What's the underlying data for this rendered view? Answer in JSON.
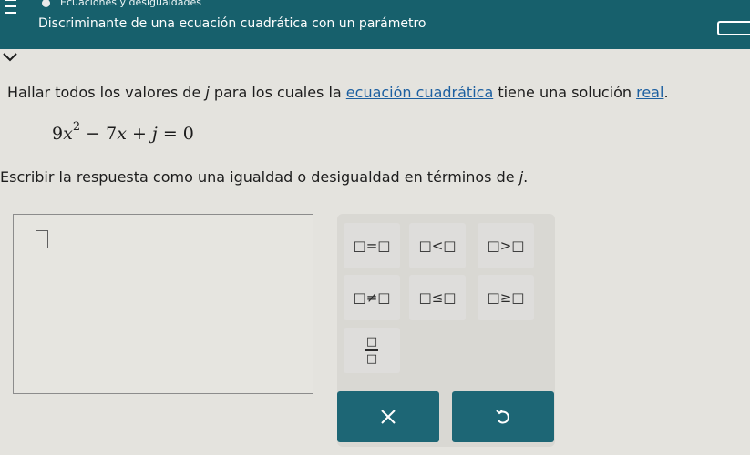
{
  "header": {
    "course": "Ecuaciones y desigualdades",
    "title": "Discriminante de una ecuación cuadrática con un parámetro"
  },
  "instruction": {
    "before": "Hallar todos los valores de ",
    "variable": "j",
    "middle": " para los cuales la ",
    "link_quadratic": "ecuación cuadrática",
    "after": " tiene una solución ",
    "link_real": "real",
    "end": "."
  },
  "equation": {
    "coef_a": "9",
    "var_x": "x",
    "exponent": "2",
    "op1": " − ",
    "coef_b": "7",
    "var_x2": "x",
    "op2": " + ",
    "var_j": "j",
    "rhs": " = 0"
  },
  "answer_prompt": {
    "text": "Escribir la respuesta como una igualdad o desigualdad en términos de ",
    "variable": "j",
    "end": "."
  },
  "palette": {
    "keys": [
      {
        "label": "□=□"
      },
      {
        "label": "□<□"
      },
      {
        "label": "□>□"
      },
      {
        "label": "□≠□"
      },
      {
        "label": "□≤□"
      },
      {
        "label": "□≥□"
      }
    ],
    "fraction": {
      "numerator": "□",
      "denominator": "□"
    },
    "clear_label": "×",
    "undo_icon": "undo-icon"
  },
  "colors": {
    "header": "#17606c",
    "action_button": "#1d6675",
    "link": "#1c5fa0"
  }
}
